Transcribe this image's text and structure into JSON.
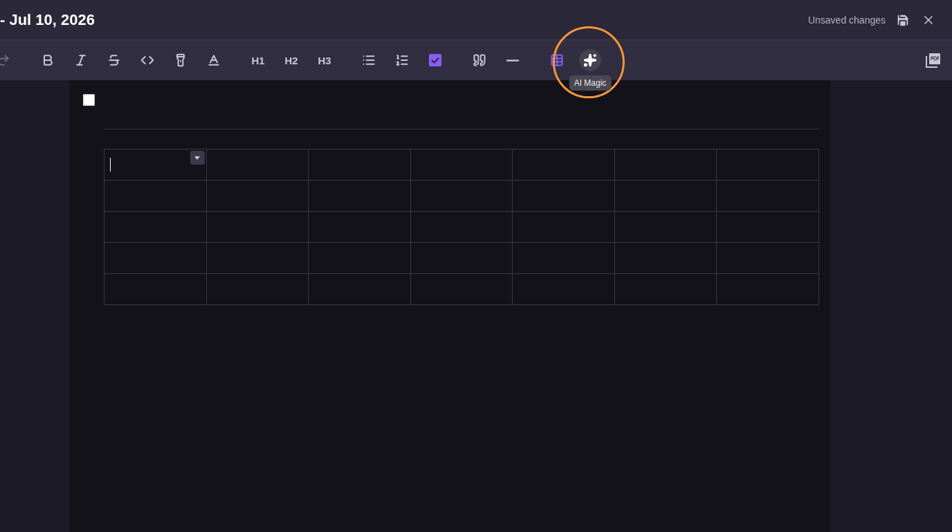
{
  "header": {
    "title": "- Jul 10, 2026",
    "status": "Unsaved changes"
  },
  "toolbar": {
    "groups": [
      [
        {
          "kind": "redo",
          "active": false,
          "highlighted": false
        }
      ],
      [
        {
          "kind": "bold",
          "active": false,
          "highlighted": false
        },
        {
          "kind": "italic",
          "active": false,
          "highlighted": false
        },
        {
          "kind": "strike",
          "active": false,
          "highlighted": false
        },
        {
          "kind": "code",
          "active": false,
          "highlighted": false
        },
        {
          "kind": "highlight",
          "active": false,
          "highlighted": false
        },
        {
          "kind": "color",
          "active": false,
          "highlighted": false
        }
      ],
      [
        {
          "kind": "heading",
          "label": "H1",
          "active": false,
          "highlighted": false
        },
        {
          "kind": "heading",
          "label": "H2",
          "active": false,
          "highlighted": false
        },
        {
          "kind": "heading",
          "label": "H3",
          "active": false,
          "highlighted": false
        }
      ],
      [
        {
          "kind": "bullets",
          "active": false,
          "highlighted": false
        },
        {
          "kind": "numbered",
          "active": false,
          "highlighted": false
        },
        {
          "kind": "task",
          "active": true,
          "highlighted": false
        }
      ],
      [
        {
          "kind": "quote",
          "active": false,
          "highlighted": false
        },
        {
          "kind": "rule",
          "active": false,
          "highlighted": false
        }
      ],
      [
        {
          "kind": "table",
          "active": true,
          "highlighted": false
        },
        {
          "kind": "ai",
          "active": false,
          "highlighted": true,
          "tooltip": "AI Magic"
        }
      ]
    ]
  },
  "task": {
    "checked": false
  },
  "table": {
    "rows": [
      {
        "cells": [
          {
            "focused": true
          },
          {
            "focused": false
          },
          {
            "focused": false
          },
          {
            "focused": false
          },
          {
            "focused": false
          },
          {
            "focused": false
          },
          {
            "focused": false
          }
        ]
      },
      {
        "cells": [
          {
            "focused": false
          },
          {
            "focused": false
          },
          {
            "focused": false
          },
          {
            "focused": false
          },
          {
            "focused": false
          },
          {
            "focused": false
          },
          {
            "focused": false
          }
        ]
      },
      {
        "cells": [
          {
            "focused": false
          },
          {
            "focused": false
          },
          {
            "focused": false
          },
          {
            "focused": false
          },
          {
            "focused": false
          },
          {
            "focused": false
          },
          {
            "focused": false
          }
        ]
      },
      {
        "cells": [
          {
            "focused": false
          },
          {
            "focused": false
          },
          {
            "focused": false
          },
          {
            "focused": false
          },
          {
            "focused": false
          },
          {
            "focused": false
          },
          {
            "focused": false
          }
        ]
      },
      {
        "cells": [
          {
            "focused": false
          },
          {
            "focused": false
          },
          {
            "focused": false
          },
          {
            "focused": false
          },
          {
            "focused": false
          },
          {
            "focused": false
          },
          {
            "focused": false
          }
        ]
      }
    ]
  }
}
